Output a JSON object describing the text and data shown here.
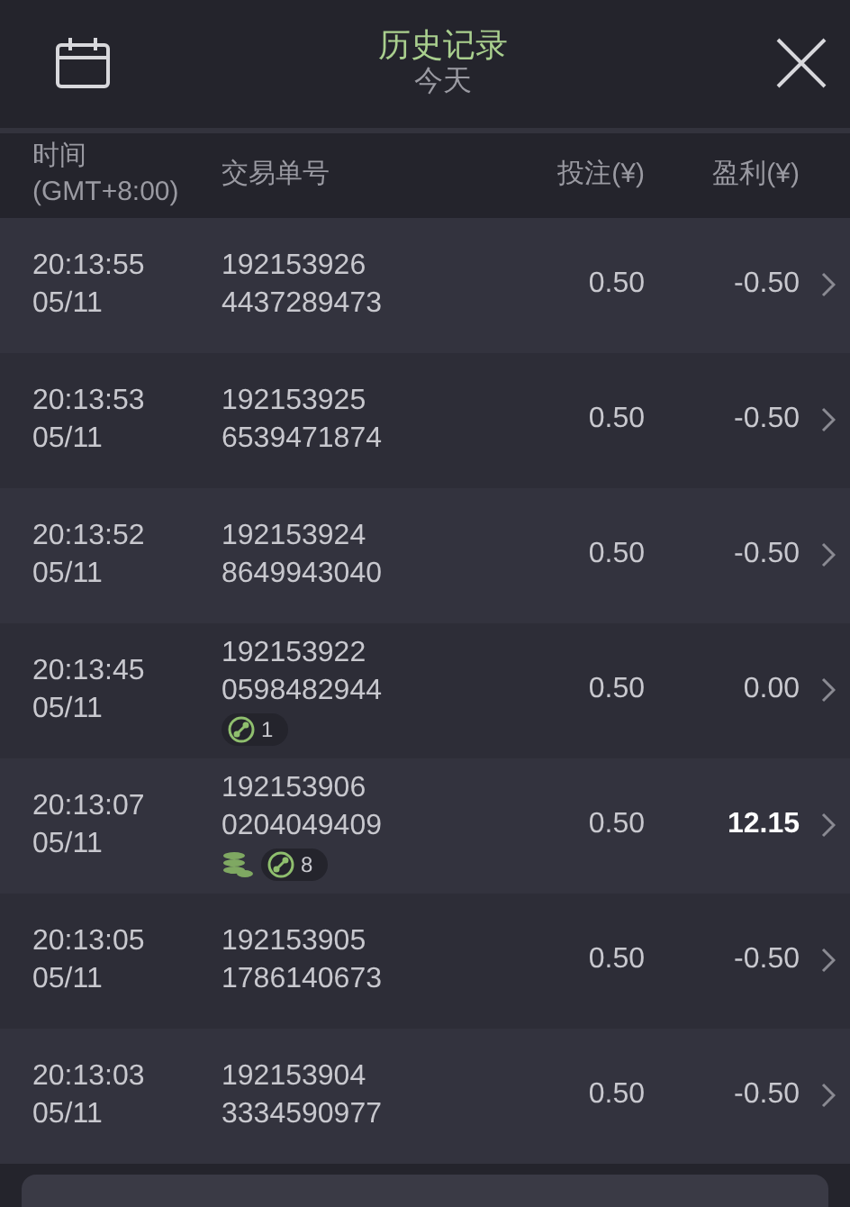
{
  "header": {
    "title": "历史记录",
    "subtitle": "今天"
  },
  "columns": [
    {
      "label": "时间",
      "sublabel": "(GMT+8:00)"
    },
    {
      "label": "交易单号"
    },
    {
      "label": "投注(¥)"
    },
    {
      "label": "盈利(¥)"
    }
  ],
  "rows": [
    {
      "time": "20:13:55",
      "date": "05/11",
      "id_1": "192153926",
      "id_2": "4437289473",
      "bet": "0.50",
      "profit": "-0.50",
      "win": false,
      "badges": []
    },
    {
      "time": "20:13:53",
      "date": "05/11",
      "id_1": "192153925",
      "id_2": "6539471874",
      "bet": "0.50",
      "profit": "-0.50",
      "win": false,
      "badges": []
    },
    {
      "time": "20:13:52",
      "date": "05/11",
      "id_1": "192153924",
      "id_2": "8649943040",
      "bet": "0.50",
      "profit": "-0.50",
      "win": false,
      "badges": []
    },
    {
      "time": "20:13:45",
      "date": "05/11",
      "id_1": "192153922",
      "id_2": "0598482944",
      "bet": "0.50",
      "profit": "0.00",
      "win": false,
      "badges": [
        {
          "kind": "spins",
          "count": "1"
        }
      ]
    },
    {
      "time": "20:13:07",
      "date": "05/11",
      "id_1": "192153906",
      "id_2": "0204049409",
      "bet": "0.50",
      "profit": "12.15",
      "win": true,
      "badges": [
        {
          "kind": "coins"
        },
        {
          "kind": "spins",
          "count": "8"
        }
      ]
    },
    {
      "time": "20:13:05",
      "date": "05/11",
      "id_1": "192153905",
      "id_2": "1786140673",
      "bet": "0.50",
      "profit": "-0.50",
      "win": false,
      "badges": []
    },
    {
      "time": "20:13:03",
      "date": "05/11",
      "id_1": "192153904",
      "id_2": "3334590977",
      "bet": "0.50",
      "profit": "-0.50",
      "win": false,
      "badges": []
    }
  ]
}
